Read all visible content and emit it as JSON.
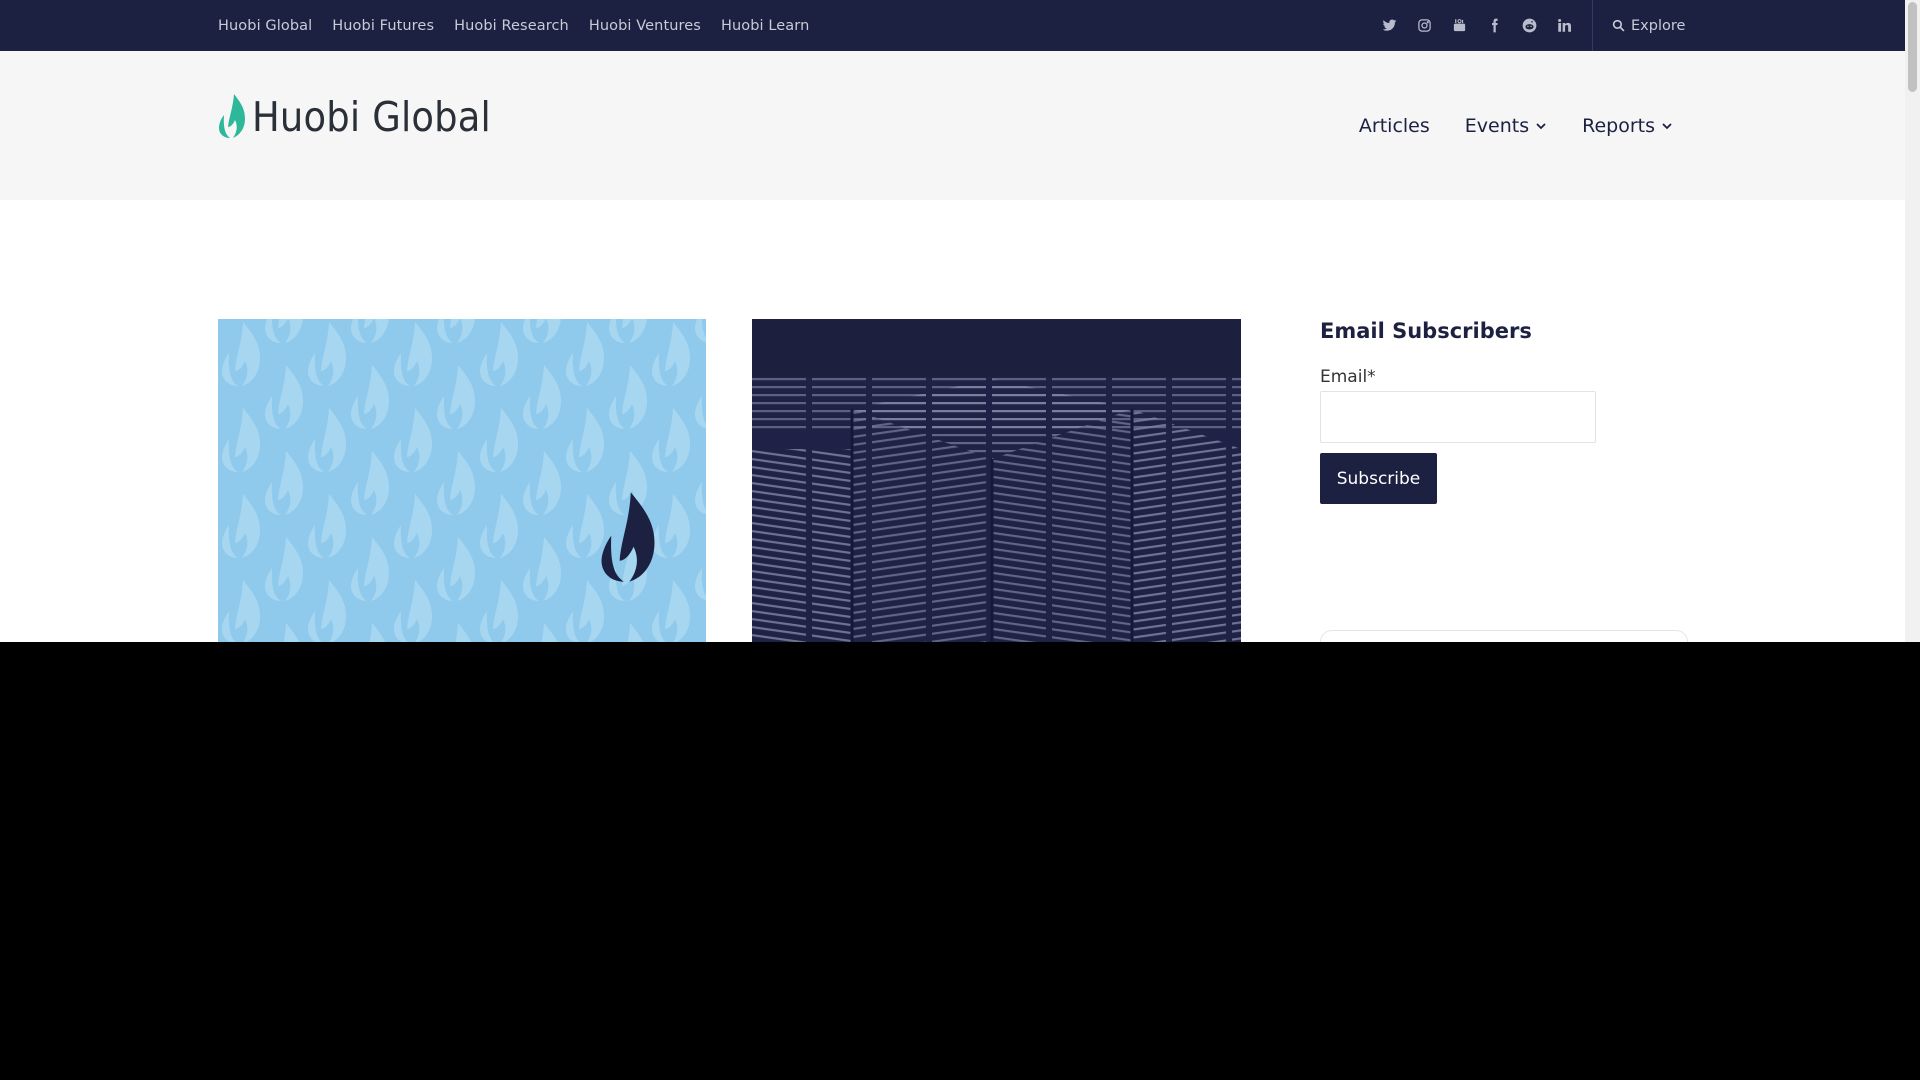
{
  "topbar": {
    "links": [
      "Huobi Global",
      "Huobi Futures",
      "Huobi Research",
      "Huobi Ventures",
      "Huobi Learn"
    ],
    "social_icons": [
      "twitter-icon",
      "instagram-icon",
      "youtube-icon",
      "facebook-icon",
      "reddit-icon",
      "linkedin-icon"
    ],
    "explore_label": "Explore"
  },
  "header": {
    "logo_text": "Huobi Global",
    "nav": {
      "articles": "Articles",
      "events": "Events",
      "reports": "Reports"
    }
  },
  "cards": [
    {
      "image": "huobi-flame-pattern-image"
    },
    {
      "image": "huobi-research-institute-image"
    }
  ],
  "sidebar": {
    "title": "Email Subscribers",
    "email_label": "Email*",
    "email_value": "",
    "subscribe_label": "Subscribe"
  },
  "colors": {
    "navy": "#1c2142",
    "teal_accent": "#2db89a",
    "card1_bg": "#8fcaec",
    "card2_bg": "#22244a"
  }
}
